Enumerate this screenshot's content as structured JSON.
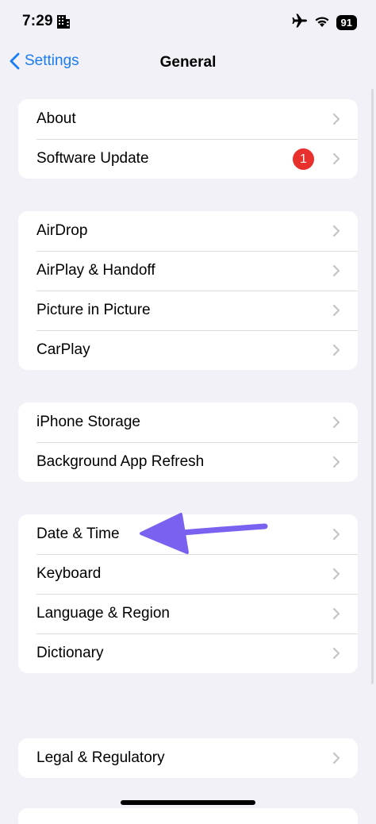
{
  "status_bar": {
    "time": "7:29",
    "battery": "91",
    "icons": [
      "building-icon",
      "airplane-icon",
      "wifi-icon",
      "battery-icon"
    ]
  },
  "navbar": {
    "back_label": "Settings",
    "title": "General"
  },
  "groups": [
    {
      "items": [
        {
          "label": "About"
        },
        {
          "label": "Software Update",
          "badge": "1"
        }
      ]
    },
    {
      "items": [
        {
          "label": "AirDrop"
        },
        {
          "label": "AirPlay & Handoff"
        },
        {
          "label": "Picture in Picture"
        },
        {
          "label": "CarPlay"
        }
      ]
    },
    {
      "items": [
        {
          "label": "iPhone Storage"
        },
        {
          "label": "Background App Refresh"
        }
      ]
    },
    {
      "items": [
        {
          "label": "Date & Time"
        },
        {
          "label": "Keyboard"
        },
        {
          "label": "Language & Region"
        },
        {
          "label": "Dictionary"
        }
      ]
    },
    {
      "items": [
        {
          "label": "Legal & Regulatory"
        }
      ]
    }
  ],
  "colors": {
    "accent": "#1a7cf5",
    "badge": "#e8302c",
    "annotation_arrow": "#7b61f0",
    "background": "#f2f1f7"
  }
}
